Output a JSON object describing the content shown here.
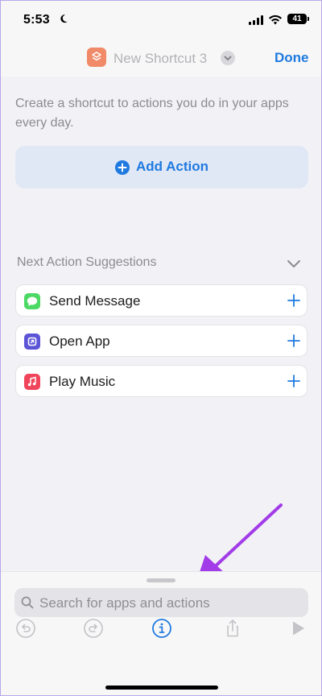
{
  "status_bar": {
    "time": "5:53",
    "battery": "41"
  },
  "nav": {
    "title": "New Shortcut 3",
    "done_label": "Done"
  },
  "intro": {
    "text": "Create a shortcut to actions you do in your apps every day."
  },
  "add_action": {
    "label": "Add Action"
  },
  "suggestions": {
    "header": "Next Action Suggestions",
    "items": [
      {
        "label": "Send Message",
        "icon": "messages-icon",
        "color": "#4cd964"
      },
      {
        "label": "Open App",
        "icon": "open-app-icon",
        "color": "#5b55d6"
      },
      {
        "label": "Play Music",
        "icon": "music-icon",
        "color": "#f0445a"
      }
    ]
  },
  "search": {
    "placeholder": "Search for apps and actions"
  },
  "colors": {
    "accent": "#1f7ae0",
    "annotation": "#a23be8"
  }
}
